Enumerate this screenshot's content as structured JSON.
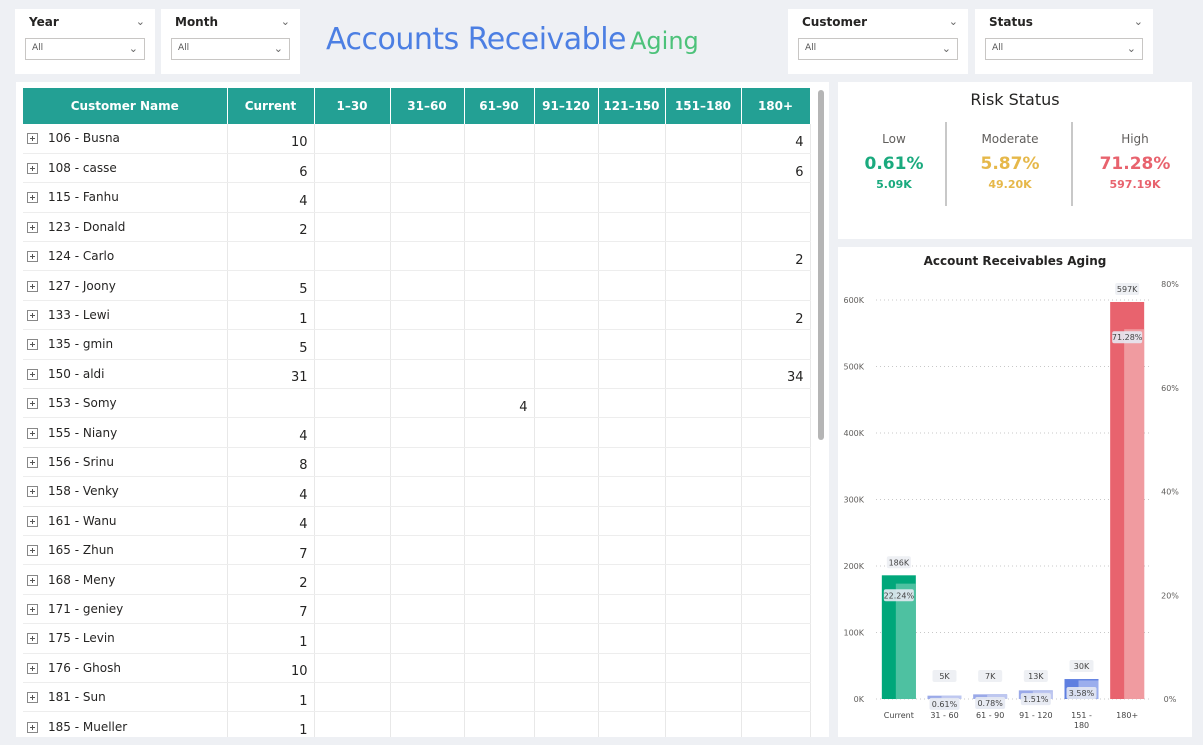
{
  "slicers": [
    {
      "label": "Year",
      "value": "All"
    },
    {
      "label": "Month",
      "value": "All"
    },
    {
      "label": "Customer",
      "value": "All"
    },
    {
      "label": "Status",
      "value": "All"
    }
  ],
  "title": {
    "main": "Accounts Receivable",
    "sub": "Aging"
  },
  "matrix": {
    "columns": [
      "Customer Name",
      "Current",
      "1–30",
      "31–60",
      "61–90",
      "91–120",
      "121–150",
      "151–180",
      "180+"
    ],
    "rows": [
      {
        "name": "106 - Busna",
        "values": [
          "10",
          "",
          "",
          "",
          "",
          "",
          "",
          "4"
        ]
      },
      {
        "name": "108 - casse",
        "values": [
          "6",
          "",
          "",
          "",
          "",
          "",
          "",
          "6"
        ]
      },
      {
        "name": "115 - Fanhu",
        "values": [
          "4",
          "",
          "",
          "",
          "",
          "",
          "",
          ""
        ]
      },
      {
        "name": "123 - Donald",
        "values": [
          "2",
          "",
          "",
          "",
          "",
          "",
          "",
          ""
        ]
      },
      {
        "name": "124 - Carlo",
        "values": [
          "",
          "",
          "",
          "",
          "",
          "",
          "",
          "2"
        ]
      },
      {
        "name": "127 - Joony",
        "values": [
          "5",
          "",
          "",
          "",
          "",
          "",
          "",
          ""
        ]
      },
      {
        "name": "133 - Lewi",
        "values": [
          "1",
          "",
          "",
          "",
          "",
          "",
          "",
          "2"
        ]
      },
      {
        "name": "135 - gmin",
        "values": [
          "5",
          "",
          "",
          "",
          "",
          "",
          "",
          ""
        ]
      },
      {
        "name": "150 - aldi",
        "values": [
          "31",
          "",
          "",
          "",
          "",
          "",
          "",
          "34"
        ]
      },
      {
        "name": "153 - Somy",
        "values": [
          "",
          "",
          "",
          "4",
          "",
          "",
          "",
          ""
        ]
      },
      {
        "name": "155 - Niany",
        "values": [
          "4",
          "",
          "",
          "",
          "",
          "",
          "",
          ""
        ]
      },
      {
        "name": "156 - Srinu",
        "values": [
          "8",
          "",
          "",
          "",
          "",
          "",
          "",
          ""
        ]
      },
      {
        "name": "158 - Venky",
        "values": [
          "4",
          "",
          "",
          "",
          "",
          "",
          "",
          ""
        ]
      },
      {
        "name": "161 - Wanu",
        "values": [
          "4",
          "",
          "",
          "",
          "",
          "",
          "",
          ""
        ]
      },
      {
        "name": "165 - Zhun",
        "values": [
          "7",
          "",
          "",
          "",
          "",
          "",
          "",
          ""
        ]
      },
      {
        "name": "168 - Meny",
        "values": [
          "2",
          "",
          "",
          "",
          "",
          "",
          "",
          ""
        ]
      },
      {
        "name": "171 - geniey",
        "values": [
          "7",
          "",
          "",
          "",
          "",
          "",
          "",
          ""
        ]
      },
      {
        "name": "175 - Levin",
        "values": [
          "1",
          "",
          "",
          "",
          "",
          "",
          "",
          ""
        ]
      },
      {
        "name": "176 - Ghosh",
        "values": [
          "10",
          "",
          "",
          "",
          "",
          "",
          "",
          ""
        ]
      },
      {
        "name": "181 - Sun",
        "values": [
          "1",
          "",
          "",
          "",
          "",
          "",
          "",
          ""
        ]
      },
      {
        "name": "185 - Mueller",
        "values": [
          "1",
          "",
          "",
          "",
          "",
          "",
          "",
          ""
        ]
      }
    ]
  },
  "risk": {
    "title": "Risk Status",
    "items": [
      {
        "label": "Low",
        "pct": "0.61%",
        "amount": "5.09K",
        "color": "#1aaa7e"
      },
      {
        "label": "Moderate",
        "pct": "5.87%",
        "amount": "49.20K",
        "color": "#e6b84a"
      },
      {
        "label": "High",
        "pct": "71.28%",
        "amount": "597.19K",
        "color": "#e8636e"
      }
    ]
  },
  "chart_data": {
    "type": "bar",
    "title": "Account Receivables Aging",
    "categories": [
      "Current",
      "31 - 60",
      "61 - 90",
      "91 - 120",
      "151 - 180",
      "180+"
    ],
    "series": [
      {
        "values": [
          186,
          5,
          7,
          13,
          30,
          597
        ],
        "labels": [
          "186K",
          "5K",
          "7K",
          "13K",
          "30K",
          "597K"
        ]
      },
      {
        "values": [
          22.24,
          0.61,
          0.78,
          1.51,
          3.58,
          71.28
        ],
        "labels": [
          "22.24%",
          "0.61%",
          "0.78%",
          "1.51%",
          "3.58%",
          "71.28%"
        ]
      }
    ],
    "y_ticks": [
      "0K",
      "100K",
      "200K",
      "300K",
      "400K",
      "500K",
      "600K"
    ],
    "y2_ticks": [
      "0%",
      "20%",
      "40%",
      "60%",
      "80%"
    ],
    "ylim": [
      0,
      600
    ],
    "y2lim": [
      0,
      80
    ],
    "colors": [
      "#00a77a",
      "#9aa9e8",
      "#9aa9e8",
      "#9aa9e8",
      "#5f7fe0",
      "#e8636e"
    ],
    "overlay_colors": [
      "#5cc6a8",
      "#c4cdf1",
      "#c4cdf1",
      "#c4cdf1",
      "#a6b6ee",
      "#f1a4a9"
    ]
  }
}
